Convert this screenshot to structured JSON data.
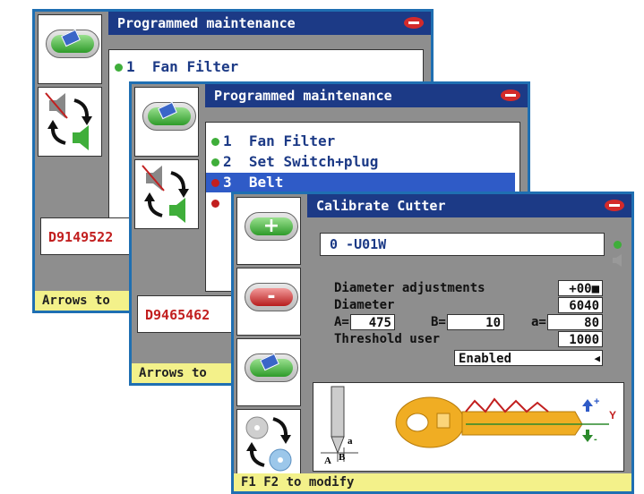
{
  "back_screen": {
    "title": "Programmed maintenance",
    "items": [
      {
        "num": "1",
        "label": "Fan Filter",
        "status": "green"
      }
    ],
    "code": "D9149522",
    "status": "Arrows to"
  },
  "mid_screen": {
    "title": "Programmed maintenance",
    "items": [
      {
        "num": "1",
        "label": "Fan Filter",
        "status": "green"
      },
      {
        "num": "2",
        "label": "Set Switch+plug",
        "status": "green"
      },
      {
        "num": "3",
        "label": "Belt",
        "status": "red"
      }
    ],
    "code": "D9465462",
    "status": "Arrows to"
  },
  "front_screen": {
    "title": "Calibrate Cutter",
    "key_code": "0 -U01W",
    "diameter_adjustments_label": "Diameter adjustments",
    "diameter_adjustments_value": "+00■",
    "diameter_label": "Diameter",
    "diameter_value": "6040",
    "A_label": "A=",
    "A_value": "475",
    "B_label": "B=",
    "B_value": "10",
    "a_label": "a=",
    "a_value": "80",
    "threshold_label": "Threshold user",
    "threshold_value": "1000",
    "mode_value": "Enabled",
    "diagram": {
      "label_A": "A",
      "label_B": "B",
      "label_a": "a",
      "label_Y": "Y",
      "plus": "+",
      "minus": "-"
    },
    "status": "F1 F2 to modify"
  },
  "colors": {
    "title_bg": "#1c3a86",
    "frame": "#1f6fb2",
    "status_bg": "#f3f18a",
    "selected": "#2f5bc7"
  },
  "icons": [
    "eraser-icon",
    "sound-cycle-icon",
    "plus-icon",
    "minus-icon",
    "disc-cycle-icon",
    "logo-icon",
    "green-status-dot-icon",
    "speaker-icon",
    "dropdown-arrow-icon"
  ]
}
